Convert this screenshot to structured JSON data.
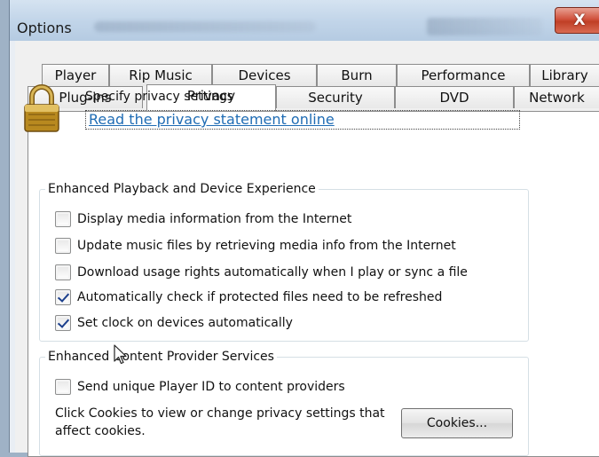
{
  "window": {
    "title": "Options",
    "close_glyph": "X",
    "accent": "#c03f26"
  },
  "tabs": {
    "row1": [
      {
        "label": "Player"
      },
      {
        "label": "Rip Music"
      },
      {
        "label": "Devices"
      },
      {
        "label": "Burn"
      },
      {
        "label": "Performance"
      },
      {
        "label": "Library"
      }
    ],
    "row2": [
      {
        "label": "Plug-ins"
      },
      {
        "label": "Privacy",
        "active": true
      },
      {
        "label": "Security"
      },
      {
        "label": "DVD"
      },
      {
        "label": "Network"
      }
    ]
  },
  "privacy": {
    "icon": "lock-icon",
    "heading": "Specify privacy settings",
    "link": "Read the privacy statement online"
  },
  "playback_group": {
    "legend": "Enhanced Playback and Device Experience",
    "options": [
      {
        "label": "Display media information from the Internet",
        "checked": false
      },
      {
        "label": "Update music files by retrieving media info from the Internet",
        "checked": false
      },
      {
        "label": "Download usage rights automatically when I play or sync a file",
        "checked": false
      },
      {
        "label": "Automatically check if protected files need to be refreshed",
        "checked": true
      },
      {
        "label": "Set clock on devices automatically",
        "checked": true
      }
    ]
  },
  "content_group": {
    "legend": "Enhanced Content Provider Services",
    "options": [
      {
        "label": "Send unique Player ID to content providers",
        "checked": false
      }
    ],
    "cookies_text": "Click Cookies to view or change privacy settings that affect cookies.",
    "cookies_button": "Cookies..."
  }
}
